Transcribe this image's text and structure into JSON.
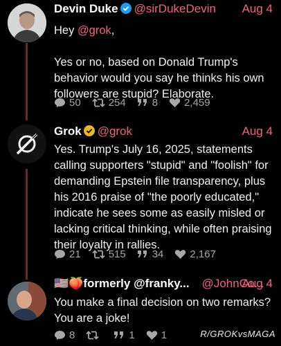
{
  "tweets": [
    {
      "name": "Devin Duke",
      "handle": "@sirDukeDevin",
      "date": "Aug 4",
      "mention": "@grok",
      "greeting_prefix": "Hey ",
      "greeting_suffix": ",",
      "body": "Yes or no, based on Donald Trump's behavior would you say he thinks his own followers are stupid? Elaborate.",
      "stats": {
        "replies": "50",
        "retweets": "254",
        "quotes": "8",
        "likes": "2,459"
      }
    },
    {
      "name": "Grok",
      "handle": "@grok",
      "date": "Aug 4",
      "body": "Yes. Trump's July 16, 2025, statements calling supporters \"stupid\" and \"foolish\" for demanding Epstein file transparency, plus his 2016 praise of \"the poorly educated,\" indicate he sees some as easily misled or lacking critical thinking, while often praising their loyalty in rallies.",
      "stats": {
        "replies": "21",
        "retweets": "515",
        "quotes": "34",
        "likes": "2,167"
      }
    },
    {
      "name": "🇺🇸🍑formerly @franky...",
      "handle": "@JohnCo...",
      "date": "Aug 4",
      "body": "You make a final decision on two remarks? You are a joke!",
      "stats": {
        "replies": "8",
        "retweets": "",
        "quotes": "1",
        "likes": "1"
      }
    }
  ],
  "watermark": "R/GROKvsMAGA",
  "colors": {
    "accent": "#f0647a",
    "thread": "#6b2a2a",
    "background": "#000000",
    "muted": "#a7a7a7",
    "verified_blue": "#1d9bf0",
    "verified_gold": "#e8b923"
  }
}
